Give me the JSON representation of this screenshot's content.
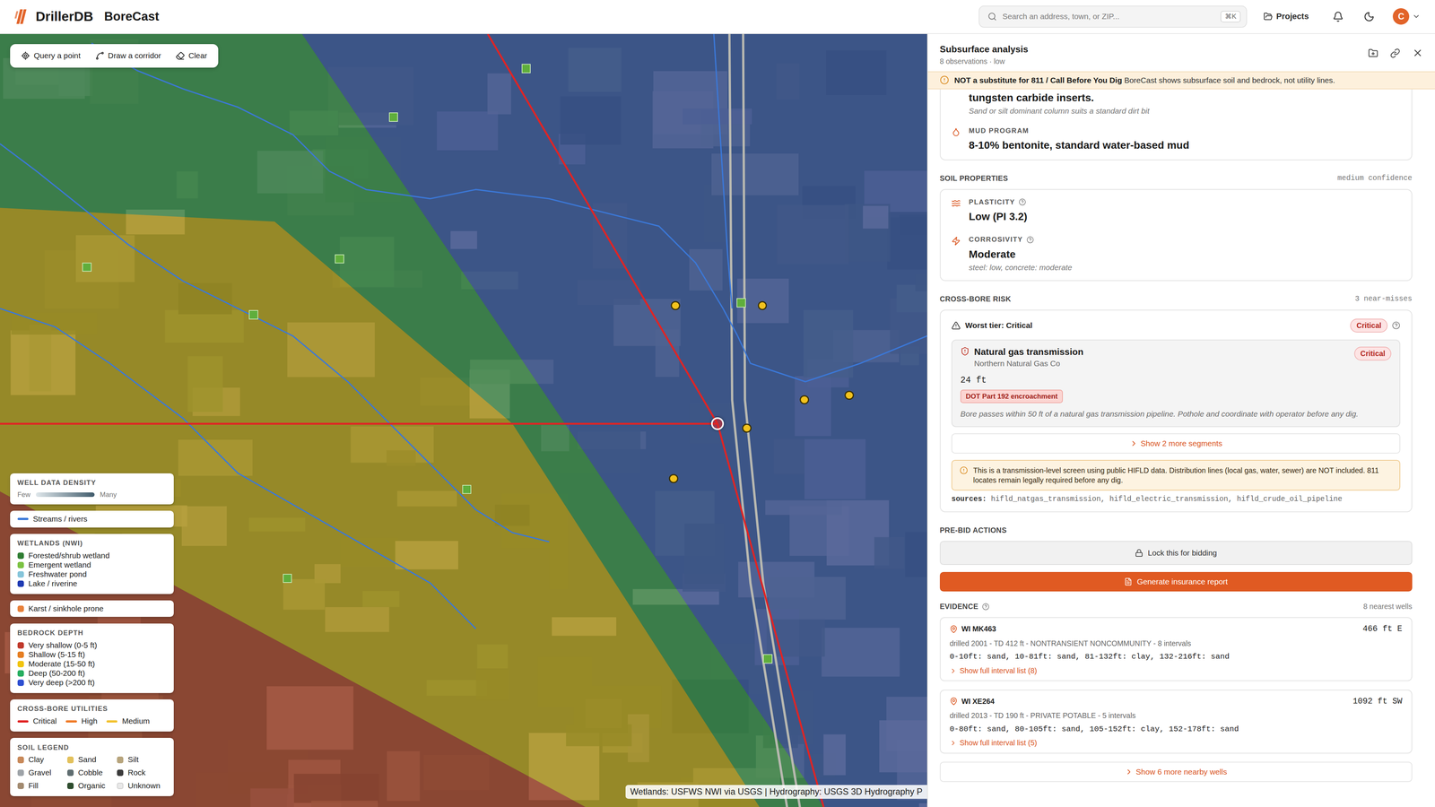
{
  "header": {
    "brand": "DrillerDB",
    "product": "BoreCast",
    "search": {
      "placeholder": "Search an address, town, or ZIP...",
      "shortcut": "⌘K"
    },
    "projects": "Projects",
    "avatar": "C"
  },
  "map": {
    "tools": [
      {
        "label": "Query a point"
      },
      {
        "label": "Draw a corridor"
      },
      {
        "label": "Clear"
      }
    ],
    "legend": {
      "density": {
        "title": "WELL DATA DENSITY",
        "min": "Few",
        "max": "Many"
      },
      "streams": {
        "label": "Streams / rivers",
        "color": "#3b78d8"
      },
      "wetlands": {
        "title": "WETLANDS (NWI)",
        "items": [
          {
            "label": "Forested/shrub wetland",
            "color": "#2f7d32"
          },
          {
            "label": "Emergent wetland",
            "color": "#7cc242"
          },
          {
            "label": "Freshwater pond",
            "color": "#86c5da"
          },
          {
            "label": "Lake / riverine",
            "color": "#1f3bb3"
          }
        ]
      },
      "karst": {
        "label": "Karst / sinkhole prone",
        "color": "#e8803a"
      },
      "bedrock": {
        "title": "BEDROCK DEPTH",
        "items": [
          {
            "label": "Very shallow (0-5 ft)",
            "color": "#c0392b"
          },
          {
            "label": "Shallow (5-15 ft)",
            "color": "#e67e22"
          },
          {
            "label": "Moderate (15-50 ft)",
            "color": "#f1c40f"
          },
          {
            "label": "Deep (50-200 ft)",
            "color": "#27ae60"
          },
          {
            "label": "Very deep (>200 ft)",
            "color": "#2e4fd1"
          }
        ]
      },
      "crossbore": {
        "title": "CROSS-BORE UTILITIES",
        "items": [
          {
            "label": "Critical",
            "color": "#e02424"
          },
          {
            "label": "High",
            "color": "#f07c2a"
          },
          {
            "label": "Medium",
            "color": "#f2c230"
          }
        ]
      },
      "soil": {
        "title": "SOIL LEGEND",
        "items": [
          {
            "label": "Clay",
            "color": "#c8895a"
          },
          {
            "label": "Sand",
            "color": "#e3c15c"
          },
          {
            "label": "Silt",
            "color": "#b7a47c"
          },
          {
            "label": "Gravel",
            "color": "#9ea3a8"
          },
          {
            "label": "Cobble",
            "color": "#5f6d70"
          },
          {
            "label": "Rock",
            "color": "#3a3a3a"
          },
          {
            "label": "Fill",
            "color": "#a38b70"
          },
          {
            "label": "Organic",
            "color": "#2e4d2e"
          },
          {
            "label": "Unknown",
            "color": "#e8e8e8"
          }
        ]
      }
    },
    "attribution": "Wetlands: USFWS NWI via USGS | Hydrography: USGS 3D Hydrography P"
  },
  "panel": {
    "title": "Subsurface analysis",
    "subtitle": "8 observations · low",
    "warning": {
      "strong": "NOT a substitute for 811 / Call Before You Dig",
      "text": "BoreCast shows subsurface soil and bedrock, not utility lines."
    },
    "drilling": {
      "bit_value": "tungsten carbide inserts.",
      "bit_note": "Sand or silt dominant column suits a standard dirt bit",
      "mud_label": "MUD PROGRAM",
      "mud_value": "8-10% bentonite, standard water-based mud"
    },
    "soil": {
      "title": "SOIL PROPERTIES",
      "confidence": "medium confidence",
      "items": [
        {
          "label": "PLASTICITY",
          "value": "Low (PI 3.2)",
          "note": ""
        },
        {
          "label": "CORROSIVITY",
          "value": "Moderate",
          "note": "steel: low, concrete: moderate"
        }
      ]
    },
    "crossbore": {
      "title": "CROSS-BORE RISK",
      "count": "3 near-misses",
      "worst": "Worst tier: Critical",
      "worst_badge": "Critical",
      "segment": {
        "name": "Natural gas transmission",
        "operator": "Northern Natural Gas Co",
        "badge": "Critical",
        "distance": "24 ft",
        "tag": "DOT Part 192 encroachment",
        "note": "Bore passes within 50 ft of a natural gas transmission pipeline. Pothole and coordinate with operator before any dig."
      },
      "more": "Show 2 more segments",
      "disclaimer": "This is a transmission-level screen using public HIFLD data. Distribution lines (local gas, water, sewer) are NOT included. 811 locates remain legally required before any dig.",
      "sources_label": "sources:",
      "sources": "hifld_natgas_transmission, hifld_electric_transmission, hifld_crude_oil_pipeline"
    },
    "actions": {
      "title": "PRE-BID ACTIONS",
      "buttons": [
        {
          "label": "Lock this for bidding",
          "kind": "secondary"
        },
        {
          "label": "Generate insurance report",
          "kind": "primary"
        }
      ]
    },
    "evidence": {
      "title": "EVIDENCE",
      "count": "8 nearest wells",
      "wells": [
        {
          "id": "WI MK463",
          "distance": "466 ft E",
          "meta": "drilled 2001 - TD 412 ft - NONTRANSIENT NONCOMMUNITY - 8 intervals",
          "intervals": "0-10ft: sand, 10-81ft: sand, 81-132ft: clay, 132-216ft: sand",
          "toggle": "Show full interval list (8)",
          "expanded": false
        },
        {
          "id": "WI XE264",
          "distance": "1092 ft SW",
          "meta": "drilled 2013 - TD 190 ft - PRIVATE POTABLE - 5 intervals",
          "intervals": "0-80ft: sand, 80-105ft: sand, 105-152ft: clay, 152-178ft: sand",
          "toggle": "Show full interval list (5)",
          "expanded": false
        }
      ],
      "more": "Show 6 more nearby wells"
    }
  }
}
